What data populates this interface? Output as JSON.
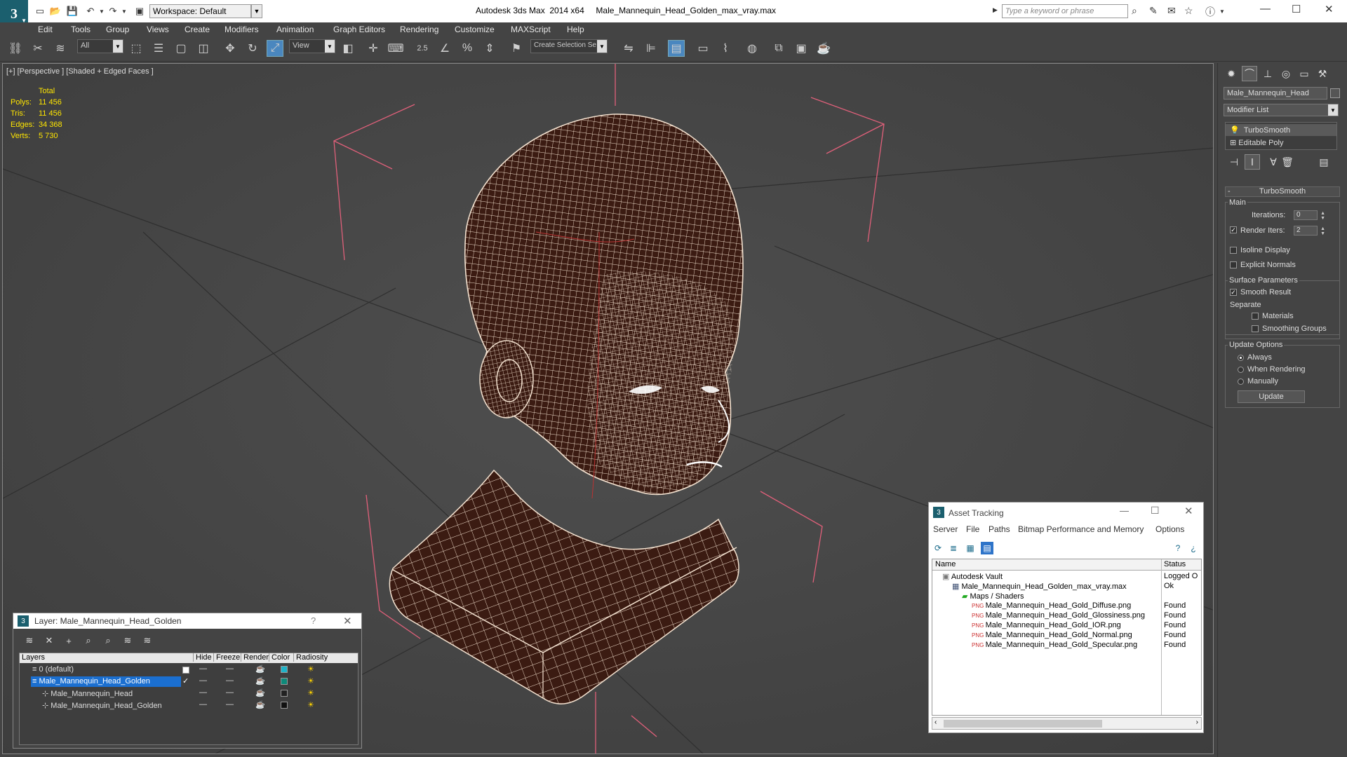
{
  "window": {
    "title": "Autodesk 3ds Max  2014 x64     Male_Mannequin_Head_Golden_max_vray.max",
    "workspace": "Workspace: Default",
    "search_placeholder": "Type a keyword or phrase"
  },
  "menu": [
    "Edit",
    "Tools",
    "Group",
    "Views",
    "Create",
    "Modifiers",
    "Animation",
    "Graph Editors",
    "Rendering",
    "Customize",
    "MAXScript",
    "Help"
  ],
  "toolbar": {
    "selection_filter": "All",
    "ref_coord": "View",
    "snap_value": "2.5",
    "named_selection_placeholder": "Create Selection Se"
  },
  "viewport": {
    "label": "[+] [Perspective ] [Shaded + Edged Faces ]",
    "stats_header": "Total",
    "stats": [
      {
        "key": "Polys:",
        "value": "11 456"
      },
      {
        "key": "Tris:",
        "value": "11 456"
      },
      {
        "key": "Edges:",
        "value": "34 368"
      },
      {
        "key": "Verts:",
        "value": "5 730"
      }
    ]
  },
  "command_panel": {
    "object_name": "Male_Mannequin_Head",
    "modifier_list": "Modifier List",
    "stack": [
      "TurboSmooth",
      "Editable Poly"
    ],
    "rollout": "TurboSmooth",
    "main_label": "Main",
    "iterations_label": "Iterations:",
    "iterations_value": "0",
    "render_iters_label": "Render Iters:",
    "render_iters_value": "2",
    "isoline": "Isoline Display",
    "explicit_normals": "Explicit Normals",
    "surface_params": "Surface Parameters",
    "smooth_result": "Smooth Result",
    "separate": "Separate",
    "materials": "Materials",
    "smoothing_groups": "Smoothing Groups",
    "update_options": "Update Options",
    "always": "Always",
    "when_rendering": "When Rendering",
    "manually": "Manually",
    "update_button": "Update"
  },
  "asset_tracking": {
    "title": "Asset Tracking",
    "menu": [
      "Server",
      "File",
      "Paths",
      "Bitmap Performance and Memory",
      "Options"
    ],
    "col_name": "Name",
    "col_status": "Status",
    "rows": [
      {
        "name": "Autodesk Vault",
        "status": "Logged O"
      },
      {
        "name": "Male_Mannequin_Head_Golden_max_vray.max",
        "status": "Ok"
      },
      {
        "name": "Maps / Shaders",
        "status": ""
      },
      {
        "name": "Male_Mannequin_Head_Gold_Diffuse.png",
        "status": "Found"
      },
      {
        "name": "Male_Mannequin_Head_Gold_Glossiness.png",
        "status": "Found"
      },
      {
        "name": "Male_Mannequin_Head_Gold_IOR.png",
        "status": "Found"
      },
      {
        "name": "Male_Mannequin_Head_Gold_Normal.png",
        "status": "Found"
      },
      {
        "name": "Male_Mannequin_Head_Gold_Specular.png",
        "status": "Found"
      }
    ]
  },
  "layer_panel": {
    "title": "Layer: Male_Mannequin_Head_Golden",
    "columns": [
      "Layers",
      "Hide",
      "Freeze",
      "Render",
      "Color",
      "Radiosity"
    ],
    "rows": [
      {
        "name": "0 (default)",
        "color": "#1fb3c8"
      },
      {
        "name": "Male_Mannequin_Head_Golden",
        "color": "#0e8a7a"
      },
      {
        "name": "Male_Mannequin_Head",
        "color": "#222222"
      },
      {
        "name": "Male_Mannequin_Head_Golden",
        "color": "#111111"
      }
    ]
  },
  "colors": {
    "accent": "#4a87bf",
    "stats": "#ffe600",
    "wire": "#f4e2d0",
    "gizmo": "#e0607a",
    "selection": "#1b6fd0"
  }
}
